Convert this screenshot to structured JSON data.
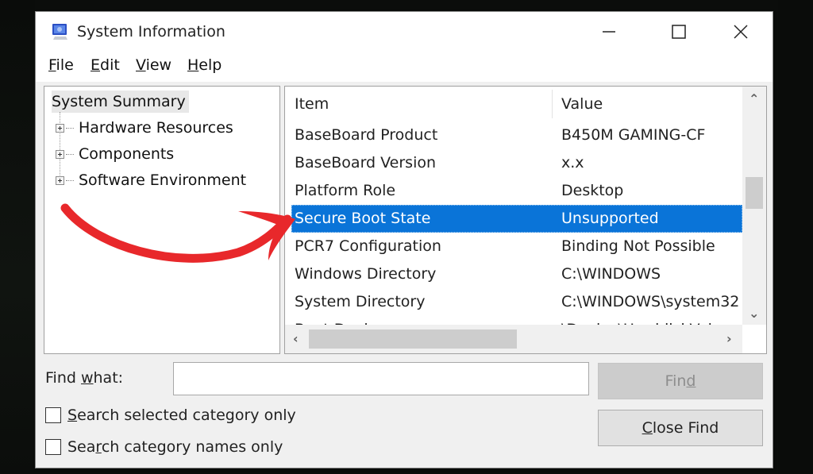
{
  "window": {
    "title": "System Information",
    "icon": "system-information-icon",
    "controls": {
      "minimize": "minimize-icon",
      "maximize": "maximize-icon",
      "close": "close-icon"
    }
  },
  "menubar": {
    "items": [
      {
        "label": "File",
        "mnemonic": "F",
        "rest": "ile"
      },
      {
        "label": "Edit",
        "mnemonic": "E",
        "rest": "dit"
      },
      {
        "label": "View",
        "mnemonic": "V",
        "rest": "iew"
      },
      {
        "label": "Help",
        "mnemonic": "H",
        "rest": "elp"
      }
    ]
  },
  "tree": {
    "root": "System Summary",
    "children": [
      {
        "label": "Hardware Resources",
        "expander": "plus"
      },
      {
        "label": "Components",
        "expander": "plus"
      },
      {
        "label": "Software Environment",
        "expander": "plus"
      }
    ]
  },
  "list": {
    "columns": [
      "Item",
      "Value"
    ],
    "rows": [
      {
        "item": "BaseBoard Product",
        "value": "B450M GAMING-CF",
        "selected": false
      },
      {
        "item": "BaseBoard Version",
        "value": "x.x",
        "selected": false
      },
      {
        "item": "Platform Role",
        "value": "Desktop",
        "selected": false
      },
      {
        "item": "Secure Boot State",
        "value": "Unsupported",
        "selected": true
      },
      {
        "item": "PCR7 Configuration",
        "value": "Binding Not Possible",
        "selected": false
      },
      {
        "item": "Windows Directory",
        "value": "C:\\WINDOWS",
        "selected": false
      },
      {
        "item": "System Directory",
        "value": "C:\\WINDOWS\\system32",
        "selected": false
      },
      {
        "item": "Boot Device",
        "value": "\\Device\\HarddiskVolum",
        "selected": false
      }
    ],
    "selection_color": "#0a74d8"
  },
  "find": {
    "label_pre": "Find ",
    "label_mnemonic": "w",
    "label_post": "hat:",
    "input_value": "",
    "find_button": {
      "pre": "Fin",
      "mnemonic": "d",
      "post": "",
      "enabled": false
    },
    "close_find_button": {
      "pre": "",
      "mnemonic": "C",
      "post": "lose Find"
    },
    "checkboxes": [
      {
        "pre": "",
        "mnemonic": "S",
        "post": "earch selected category only",
        "checked": false
      },
      {
        "pre": "Sea",
        "mnemonic": "r",
        "post": "ch category names only",
        "checked": false
      }
    ]
  },
  "annotation": {
    "type": "curved-arrow",
    "color": "#e8282b",
    "points_to": "Secure Boot State"
  }
}
